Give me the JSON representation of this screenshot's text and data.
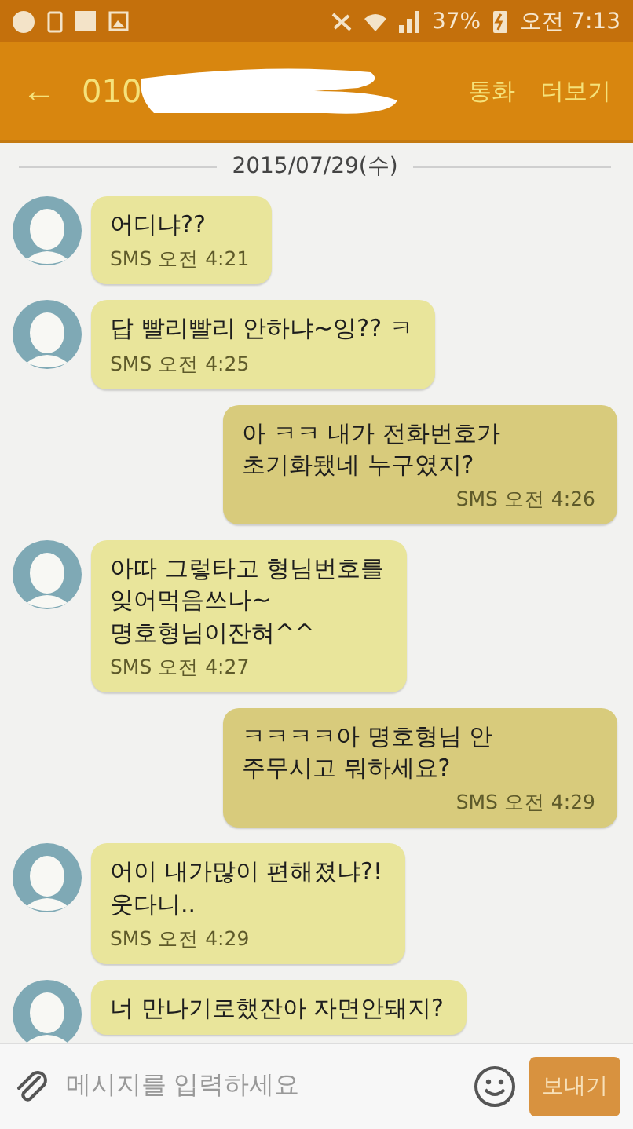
{
  "status_bar": {
    "battery": "37%",
    "time": "오전 7:13"
  },
  "header": {
    "back": "←",
    "title": "010",
    "actions": [
      "통화",
      "더보기"
    ]
  },
  "date": "2015/07/29(수)",
  "messages": [
    {
      "kind": "incoming",
      "text": "어디냐??",
      "meta": "SMS 오전 4:21"
    },
    {
      "kind": "incoming",
      "text": "답 빨리빨리 안하냐~잉??  ㅋ",
      "meta": "SMS 오전 4:25"
    },
    {
      "kind": "outgoing",
      "text": "아 ㅋㅋ 내가 전화번호가\n초기화됐네 누구였지?",
      "meta": "SMS 오전 4:26"
    },
    {
      "kind": "incoming",
      "text": "아따 그렇타고 형님번호를\n잊어먹음쓰나~\n명호형님이잔혀^^",
      "meta": "SMS 오전 4:27"
    },
    {
      "kind": "outgoing",
      "text": "ㅋㅋㅋㅋ아 명호형님 안\n주무시고 뭐하세요?",
      "meta": "SMS 오전 4:29"
    },
    {
      "kind": "incoming",
      "text": "어이 내가많이 편해졌냐?!\n웃다니..",
      "meta": "SMS 오전 4:29"
    },
    {
      "kind": "incoming",
      "text": "너 만나기로했잔아 자면안돼지?"
    }
  ],
  "composer": {
    "placeholder": "메시지를 입력하세요",
    "send": "보내기"
  }
}
